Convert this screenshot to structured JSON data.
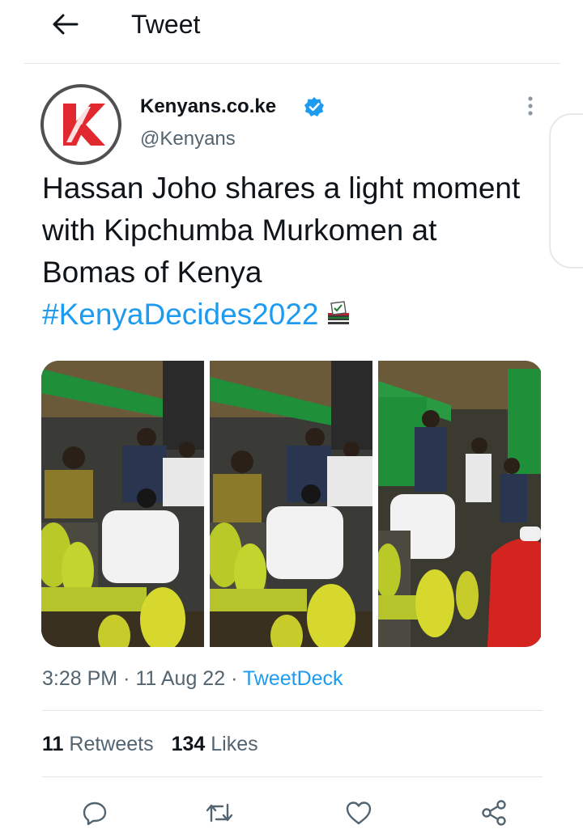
{
  "header": {
    "title": "Tweet",
    "back_icon": "arrow-left-icon"
  },
  "author": {
    "display_name": "Kenyans.co.ke",
    "handle": "@Kenyans",
    "verified": true,
    "avatar_letter": "K",
    "brand_color": "#e0282e"
  },
  "tweet": {
    "text": "Hassan Joho shares a light moment with Kipchumba Murkomen at Bomas of Kenya",
    "hashtag": "#KenyaDecides2022",
    "emoji": "ballot-box-icon"
  },
  "media": {
    "frames": [
      "frame-1",
      "frame-2",
      "frame-3"
    ]
  },
  "meta": {
    "time": "3:28 PM",
    "date": "11 Aug 22",
    "separator": "·",
    "source": "TweetDeck"
  },
  "stats": {
    "retweets_count": "11",
    "retweets_label": "Retweets",
    "likes_count": "134",
    "likes_label": "Likes"
  },
  "actions": [
    "reply-icon",
    "retweet-icon",
    "like-icon",
    "share-icon"
  ],
  "colors": {
    "accent": "#1d9bf0",
    "secondary_text": "#536471",
    "primary_text": "#0f1419",
    "divider": "#e2e6ea"
  }
}
